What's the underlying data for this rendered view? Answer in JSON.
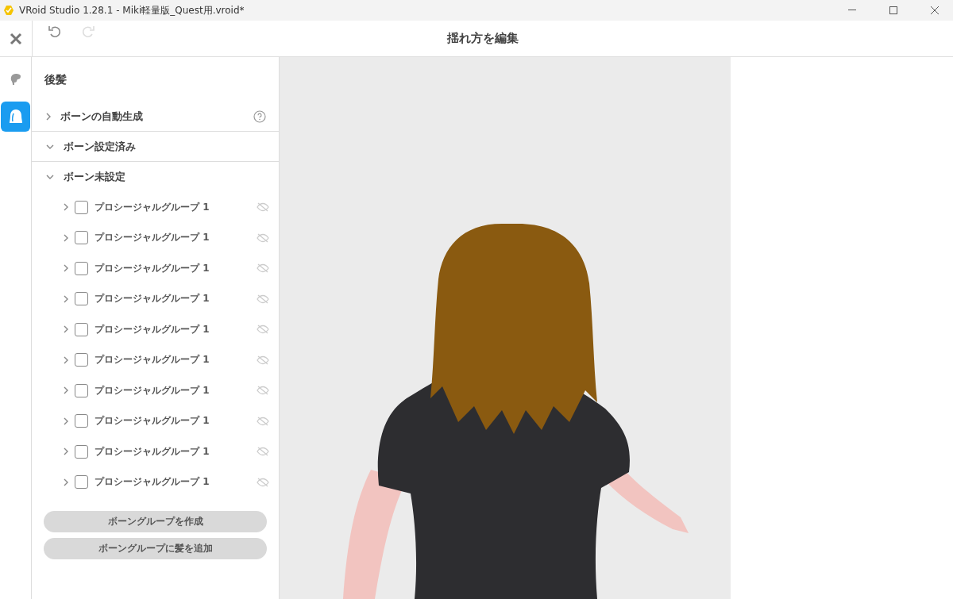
{
  "window": {
    "title": "VRoid Studio 1.28.1 - Miki軽量版_Quest用.vroid*"
  },
  "toolbar": {
    "title": "揺れ方を編集",
    "undo_disabled": false,
    "redo_disabled": true
  },
  "rail": [
    {
      "kind": "face",
      "selected": false
    },
    {
      "kind": "hair",
      "selected": true
    }
  ],
  "panel": {
    "heading": "後髪",
    "sections": [
      {
        "label": "ボーンの自動生成",
        "expanded": false,
        "help": true
      },
      {
        "label": "ボーン設定済み",
        "expanded": true,
        "help": false
      },
      {
        "label": "ボーン未設定",
        "expanded": true,
        "help": false,
        "children": [
          {
            "label": "プロシージャルグループ 1",
            "checked": false
          },
          {
            "label": "プロシージャルグループ 1",
            "checked": false
          },
          {
            "label": "プロシージャルグループ 1",
            "checked": false
          },
          {
            "label": "プロシージャルグループ 1",
            "checked": false
          },
          {
            "label": "プロシージャルグループ 1",
            "checked": false
          },
          {
            "label": "プロシージャルグループ 1",
            "checked": false
          },
          {
            "label": "プロシージャルグループ 1",
            "checked": false
          },
          {
            "label": "プロシージャルグループ 1",
            "checked": false
          },
          {
            "label": "プロシージャルグループ 1",
            "checked": false
          },
          {
            "label": "プロシージャルグループ 1",
            "checked": false
          }
        ]
      }
    ],
    "buttons": [
      "ボーングループを作成",
      "ボーングループに髪を追加"
    ]
  }
}
